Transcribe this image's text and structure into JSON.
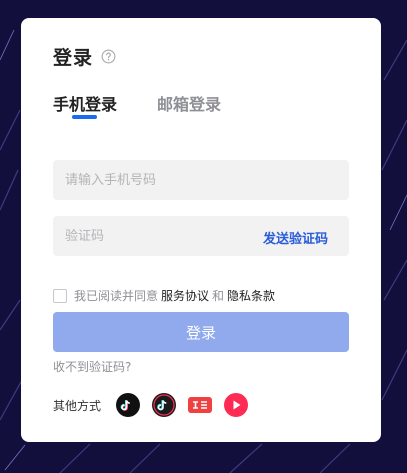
{
  "login": {
    "title": "登录",
    "tabs": [
      {
        "label": "手机登录",
        "active": true
      },
      {
        "label": "邮箱登录",
        "active": false
      }
    ],
    "phone_placeholder": "请输入手机号码",
    "code_placeholder": "验证码",
    "send_code": "发送验证码",
    "agreement": {
      "prefix": "我已阅读并同意",
      "service_link": "服务协议",
      "and": "和",
      "privacy_link": "隐私条款",
      "checked": false
    },
    "submit_label": "登录",
    "no_code": "收不到验证码?",
    "other_methods_label": "其他方式",
    "social_icons": [
      "douyin-icon",
      "douyin-lite-icon",
      "toutiao-icon",
      "xigua-icon"
    ]
  },
  "colors": {
    "background": "#130f3c",
    "accent": "#1a6bf2",
    "link": "#2a5bd8",
    "button_disabled": "#91aaee"
  }
}
